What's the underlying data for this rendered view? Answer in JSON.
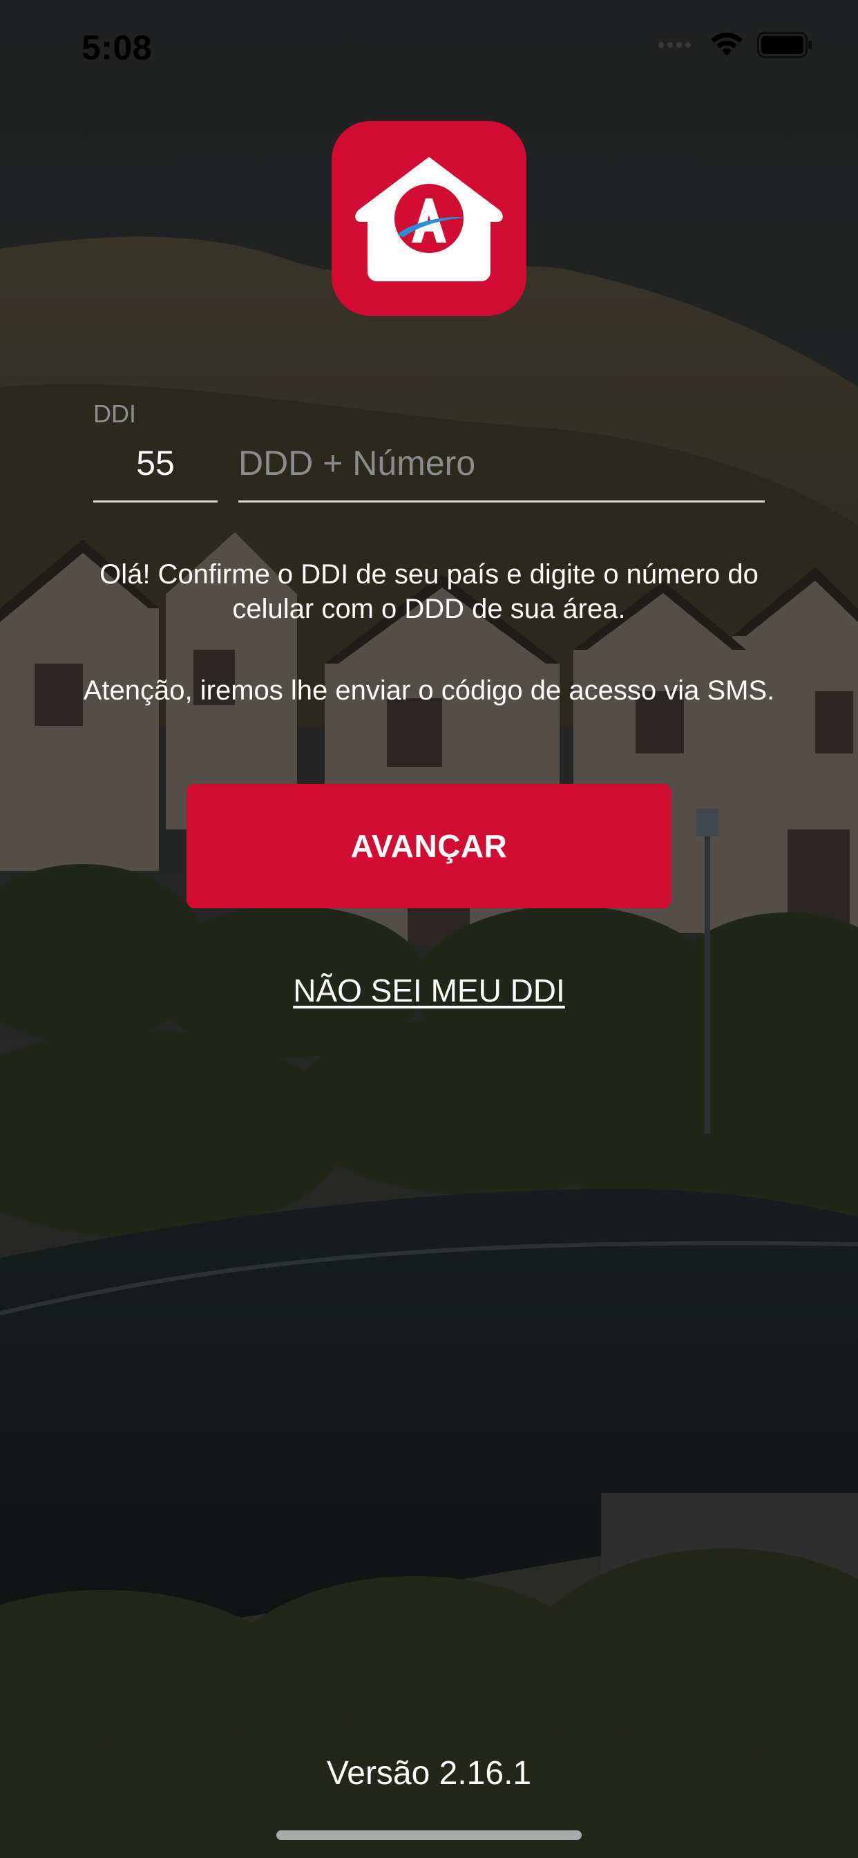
{
  "status_bar": {
    "time": "5:08",
    "icons": [
      "signal-icon",
      "wifi-icon",
      "battery-icon"
    ]
  },
  "logo": {
    "icon": "house-logo-icon",
    "letter": "A",
    "colors": {
      "brand_red": "#d20b33",
      "swoosh_blue": "#2a8fd6",
      "house_white": "#ffffff"
    }
  },
  "form": {
    "ddi_label": "DDI",
    "ddi_value": "55",
    "phone_placeholder": "DDD + Número",
    "phone_value": ""
  },
  "messages": {
    "instruction": "Olá! Confirme o DDI de seu país e digite o número do celular com o DDD de sua área.",
    "sms_notice": "Atenção, iremos lhe enviar o código de acesso via SMS."
  },
  "actions": {
    "advance_label": "AVANÇAR",
    "ddi_help_label": "NÃO SEI MEU DDI"
  },
  "footer": {
    "version": "Versão 2.16.1"
  },
  "colors": {
    "accent": "#d20b33",
    "placeholder": "#8a8c8d",
    "underline": "#d9d9d9"
  }
}
